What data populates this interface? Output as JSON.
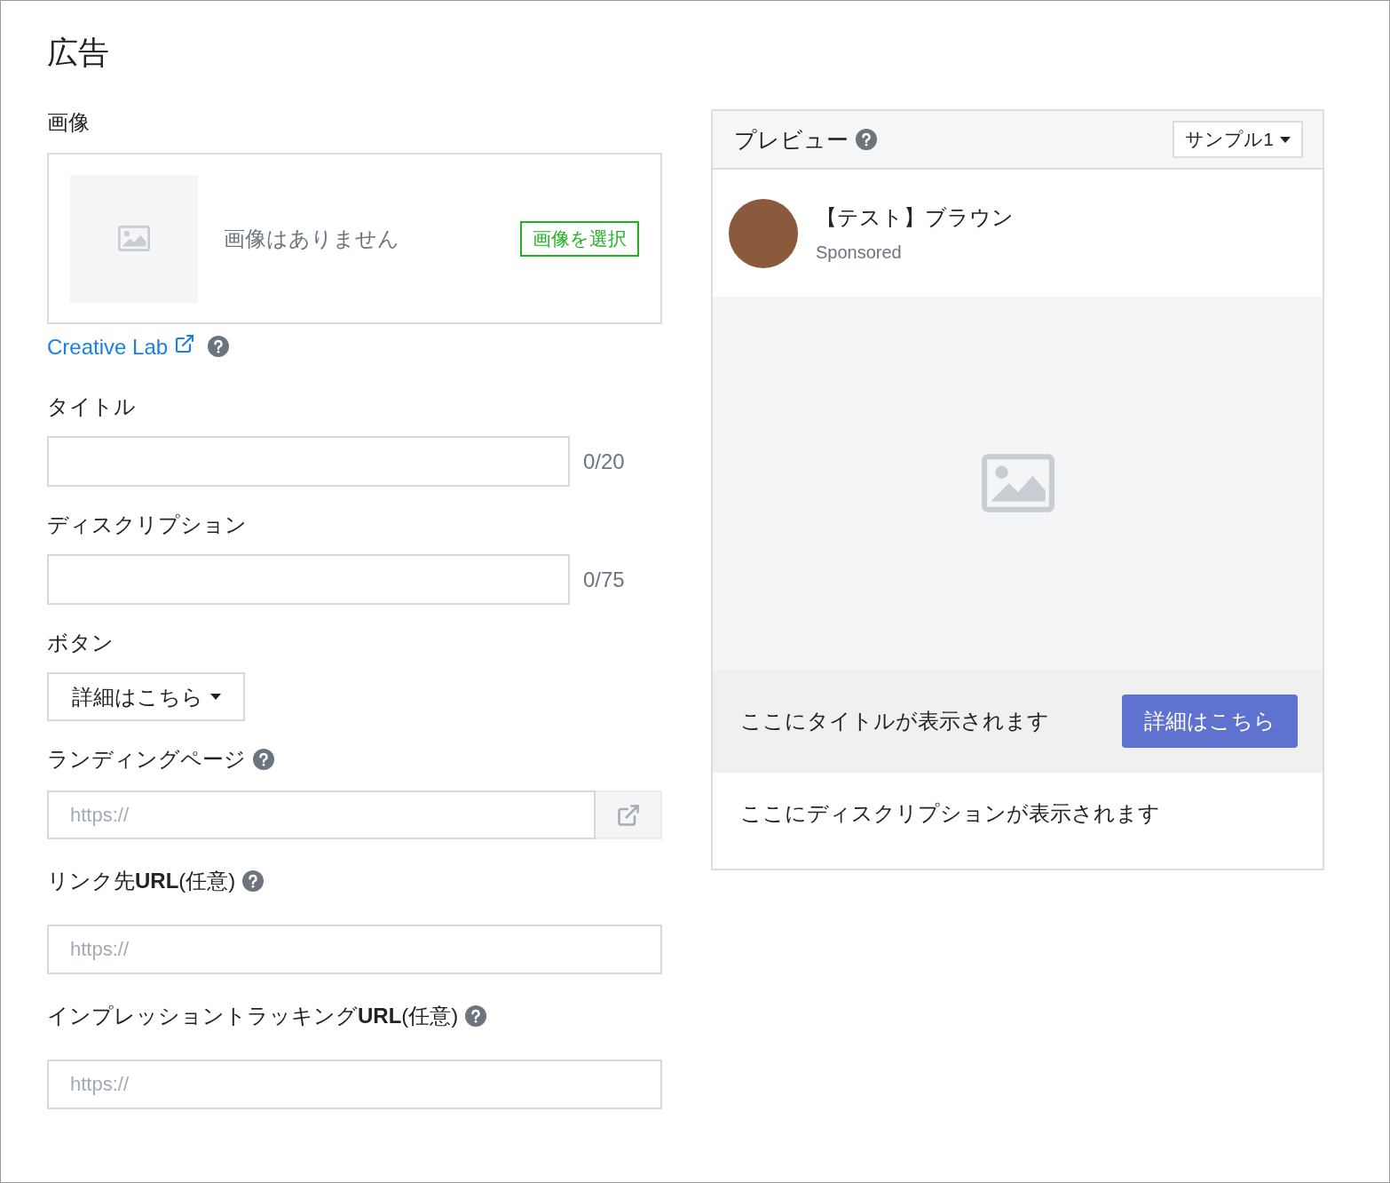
{
  "title": "広告",
  "image_section": {
    "label": "画像",
    "empty_text": "画像はありません",
    "select_button": "画像を選択"
  },
  "creative_lab": {
    "link": "Creative Lab",
    "help": true
  },
  "fields": [
    {
      "kind": "counter",
      "label": "タイトル",
      "counter": "0/20"
    },
    {
      "kind": "counter",
      "label": "ディスクリプション",
      "counter": "0/75"
    },
    {
      "kind": "dropdown",
      "label": "ボタン",
      "value": "詳細はこちら"
    },
    {
      "kind": "url_open",
      "label": "ランディングページ",
      "help": true,
      "placeholder": "https://"
    },
    {
      "kind": "url",
      "label": "リンク先**URL**(任意)",
      "help": true,
      "placeholder": "https://"
    },
    {
      "kind": "url",
      "label": "インプレッショントラッキング**URL**(任意)",
      "help": true,
      "placeholder": "https://"
    }
  ],
  "preview": {
    "title": "プレビュー",
    "help": true,
    "sample_select": "サンプル1",
    "account_name": "【テスト】ブラウン",
    "sponsored": "Sponsored",
    "title_placeholder": "ここにタイトルが表示されます",
    "cta_button": "詳細はこちら",
    "description_placeholder": "ここにディスクリプションが表示されます"
  }
}
